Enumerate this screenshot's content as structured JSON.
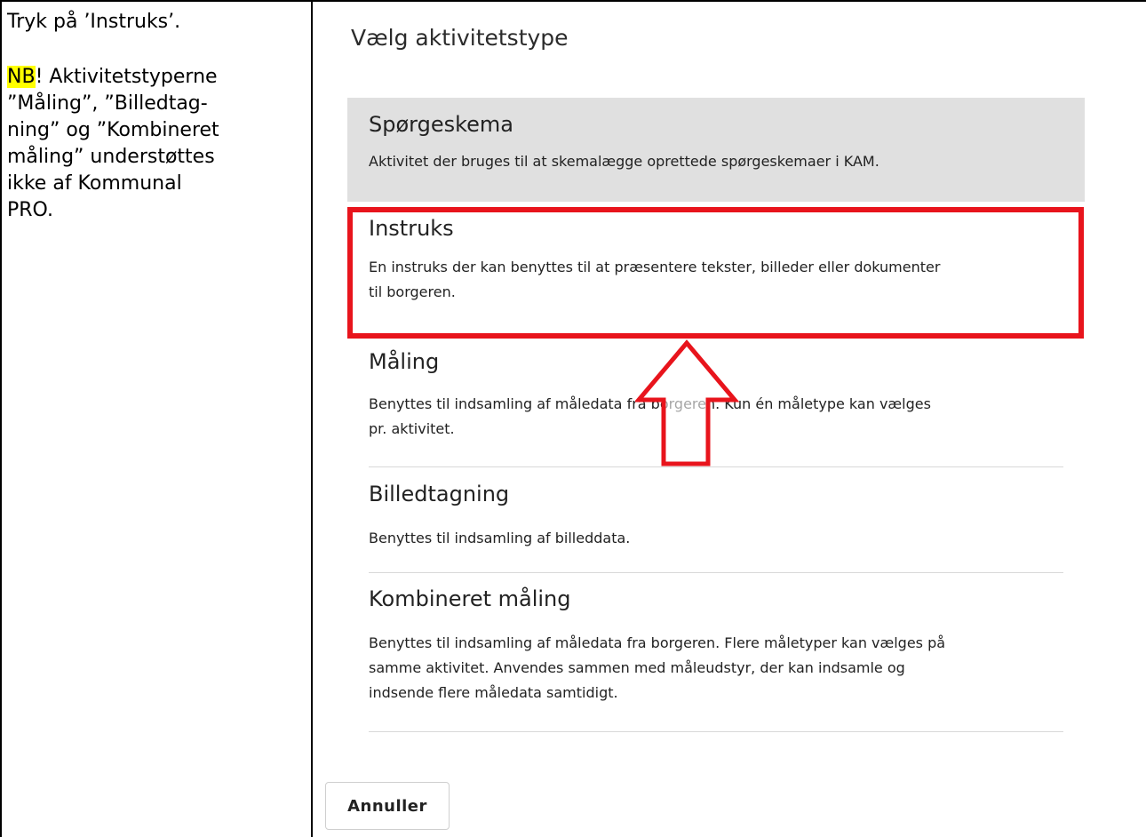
{
  "instruction": {
    "line1": "Tryk på ’Instruks’.",
    "nb_highlight": "NB",
    "note_lines": [
      "! Aktivitetstyperne",
      "”Måling”, ”Billedtag-",
      "ning” og ”Kombineret",
      "måling” understøttes",
      "ikke af Kommunal",
      "PRO."
    ]
  },
  "dialog": {
    "title": "Vælg aktivitetstype",
    "options": [
      {
        "title": "Spørgeskema",
        "desc_lines": [
          "Aktivitet der bruges til at skemalægge oprettede spørgeskemaer i KAM."
        ]
      },
      {
        "title": "Instruks",
        "desc_lines": [
          "En instruks der kan benyttes til at præsentere tekster, billeder eller dokumenter",
          "til borgeren."
        ]
      },
      {
        "title": "Måling",
        "desc_lines": [
          "Benyttes til indsamling af måledata fra borgeren. Kun én måletype kan vælges",
          "pr. aktivitet."
        ]
      },
      {
        "title": "Billedtagning",
        "desc_lines": [
          "Benyttes til indsamling af billeddata."
        ]
      },
      {
        "title": "Kombineret måling",
        "desc_lines": [
          "Benyttes til indsamling af måledata fra borgeren. Flere måletyper kan vælges på",
          "samme aktivitet. Anvendes sammen med måleudstyr, der kan indsamle og",
          "indsende flere måledata samtidigt."
        ]
      }
    ],
    "cancel_label": "Annuller"
  },
  "colors": {
    "selected_background": "#e0e0e0",
    "highlight_red": "#e8141c",
    "nb_highlight": "#ffff00"
  }
}
